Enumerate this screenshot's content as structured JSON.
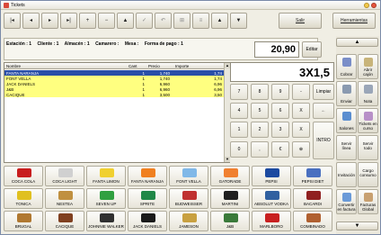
{
  "window": {
    "title": "Tickets"
  },
  "toolbar": {
    "buttons": [
      "|◂",
      "◂",
      "▸",
      "▸|",
      "+",
      "−",
      "▲",
      "✓",
      "↶",
      "⊞",
      "≡",
      "▲",
      "▼"
    ],
    "exit_label": "Salir",
    "tools_label": "Herramientas"
  },
  "info": {
    "estacion": "Estación : 1",
    "cliente": "Cliente : 1",
    "almacen": "Almacén : 1",
    "camarero": "Camarero :",
    "mesa": "Mesa :",
    "forma_pago": "Forma de pago : 1",
    "total": "20,90",
    "edit_label": "Editar"
  },
  "ticket": {
    "columns": [
      "Nombre",
      "Cant",
      "Precio",
      "Importe"
    ],
    "rows": [
      {
        "name": "FANTA NARANJA",
        "qty": "1",
        "price": "1,740",
        "amount": "1,74"
      },
      {
        "name": "FONT VELLA",
        "qty": "1",
        "price": "1,740",
        "amount": "1,74"
      },
      {
        "name": "JACK DANIELS",
        "qty": "1",
        "price": "6,960",
        "amount": "6,96"
      },
      {
        "name": "J&B",
        "qty": "1",
        "price": "6,960",
        "amount": "6,96"
      },
      {
        "name": "CACIQUE",
        "qty": "1",
        "price": "3,500",
        "amount": "3,50"
      }
    ]
  },
  "keypad": {
    "display": "3X1,5",
    "keys": [
      "7",
      "8",
      "9",
      "-",
      "Limpiar",
      "4",
      "5",
      "6",
      "X",
      "←",
      "1",
      "2",
      "3",
      "X",
      "INTRO",
      "0",
      ",",
      "€",
      "⊕"
    ]
  },
  "sidebar": {
    "buttons": [
      "Cobrar",
      "Abrir cajón",
      "Enviar",
      "Nota",
      "Salones",
      "Tickets en curso",
      "Servir línea",
      "Servir todo",
      "Invitación",
      "Cargo consumo",
      "Convertir en factura",
      "Facturas Global"
    ]
  },
  "products": [
    "COCA COLA",
    "COCA LIGHT",
    "FANTA LIMON",
    "FANTA NARANJA",
    "FONT VELLA",
    "GATORADE",
    "PEPSI",
    "PEPSI DIET",
    "TONICA",
    "NESTEA",
    "SEVEN UP",
    "SPRITE",
    "BUDWEISSER",
    "MARTINI",
    "ABSOLUT VODKA",
    "BACARDI",
    "BRUGAL",
    "CACIQUE",
    "JOHNNIE WALKER",
    "JACK DANIELS",
    "JAMESON",
    "J&B",
    "MARLBORO",
    "COMBINADO"
  ],
  "colors": {
    "selected_row": "#2a4fa8",
    "ticket_row": "#ffff80",
    "window_bg": "#f0eee4"
  }
}
